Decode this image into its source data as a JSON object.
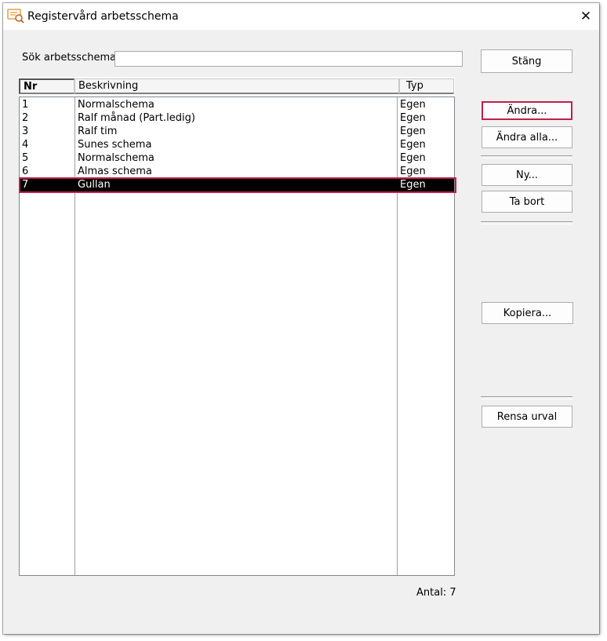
{
  "window": {
    "title": "Registervård arbetsschema",
    "close_label": "✕"
  },
  "search": {
    "label": "Sök arbetsschema",
    "value": ""
  },
  "list": {
    "columns": [
      "Nr",
      "Beskrivning",
      "Typ"
    ],
    "rows": [
      {
        "nr": "1",
        "desc": "Normalschema",
        "typ": "Egen"
      },
      {
        "nr": "2",
        "desc": "Ralf månad (Part.ledig)",
        "typ": "Egen"
      },
      {
        "nr": "3",
        "desc": "Ralf tim",
        "typ": "Egen"
      },
      {
        "nr": "4",
        "desc": "Sunes schema",
        "typ": "Egen"
      },
      {
        "nr": "5",
        "desc": "Normalschema",
        "typ": "Egen"
      },
      {
        "nr": "6",
        "desc": "Almas schema",
        "typ": "Egen"
      },
      {
        "nr": "7",
        "desc": "Gullan",
        "typ": "Egen"
      }
    ],
    "selected_nr": "7"
  },
  "buttons": {
    "stang": "Stäng",
    "andra": "Ändra...",
    "andra_alla": "Ändra alla...",
    "ny": "Ny...",
    "ta_bort": "Ta bort",
    "kopiera": "Kopiera...",
    "rensa_urval": "Rensa urval"
  },
  "footer": {
    "antal": "Antal: 7"
  },
  "colors": {
    "highlight": "#c0204a",
    "selection": "#000000",
    "app_icon": "#e8a040"
  },
  "icons": {
    "app": "schedule-app-icon",
    "close": "close-icon"
  }
}
